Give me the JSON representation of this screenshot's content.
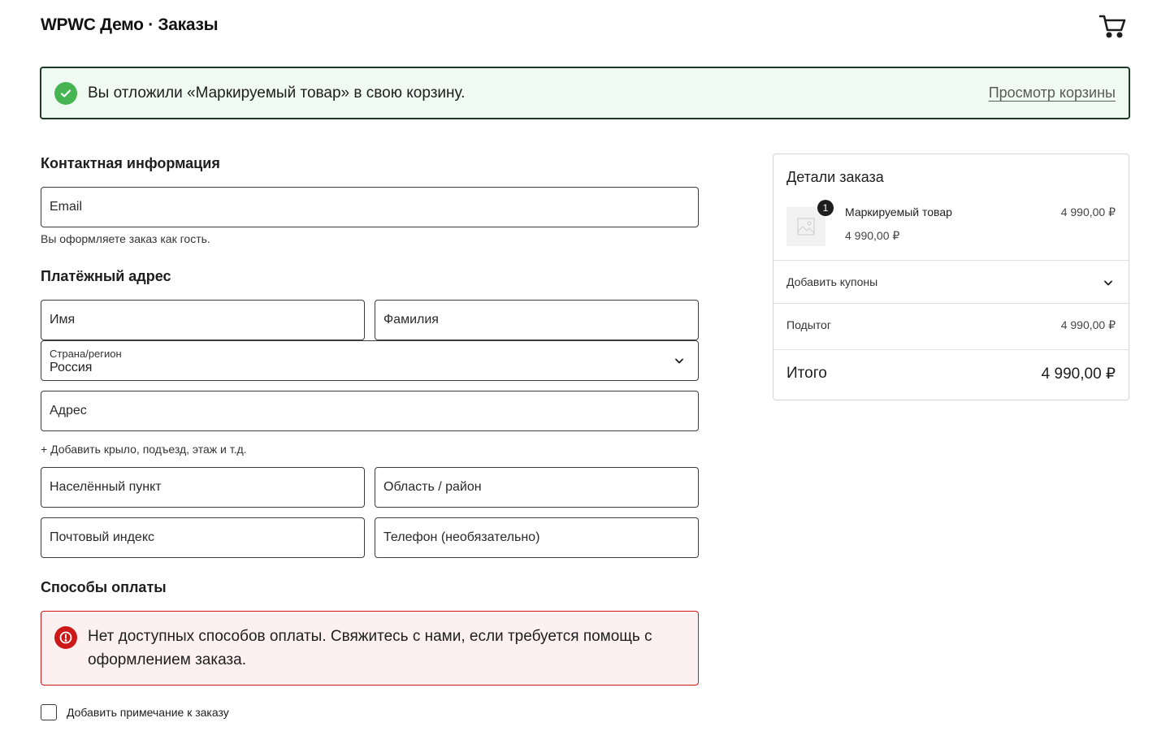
{
  "header": {
    "site_title": "WPWC Демо · Заказы",
    "cart_icon": "cart-icon"
  },
  "notice": {
    "message": "Вы отложили «Маркируемый товар» в свою корзину.",
    "link": "Просмотр корзины",
    "icon": "check-circle-icon",
    "color": "#46b450"
  },
  "contact": {
    "title": "Контактная информация",
    "email_placeholder": "Email",
    "guest_hint": "Вы оформляете заказ как гость."
  },
  "billing": {
    "title": "Платёжный адрес",
    "first_name_placeholder": "Имя",
    "last_name_placeholder": "Фамилия",
    "country_label": "Страна/регион",
    "country_value": "Россия",
    "address_placeholder": "Адрес",
    "add_address_line": "+ Добавить крыло, подъезд, этаж и т.д.",
    "city_placeholder": "Населённый пункт",
    "state_placeholder": "Область / район",
    "postcode_placeholder": "Почтовый индекс",
    "phone_placeholder": "Телефон (необязательно)"
  },
  "payment": {
    "title": "Способы оплаты",
    "error_message": "Нет доступных способов оплаты. Свяжитесь с нами, если требуется помощь с оформлением заказа.",
    "error_icon": "alert-circle-icon",
    "error_color": "#cc1818"
  },
  "order_note": {
    "label": "Добавить примечание к заказу"
  },
  "summary": {
    "title": "Детали заказа",
    "product": {
      "name": "Маркируемый товар",
      "quantity": "1",
      "unit_price": "4 990,00 ₽",
      "line_price": "4 990,00 ₽"
    },
    "coupon_label": "Добавить купоны",
    "subtotal_label": "Подытог",
    "subtotal_value": "4 990,00 ₽",
    "total_label": "Итого",
    "total_value": "4 990,00 ₽"
  }
}
